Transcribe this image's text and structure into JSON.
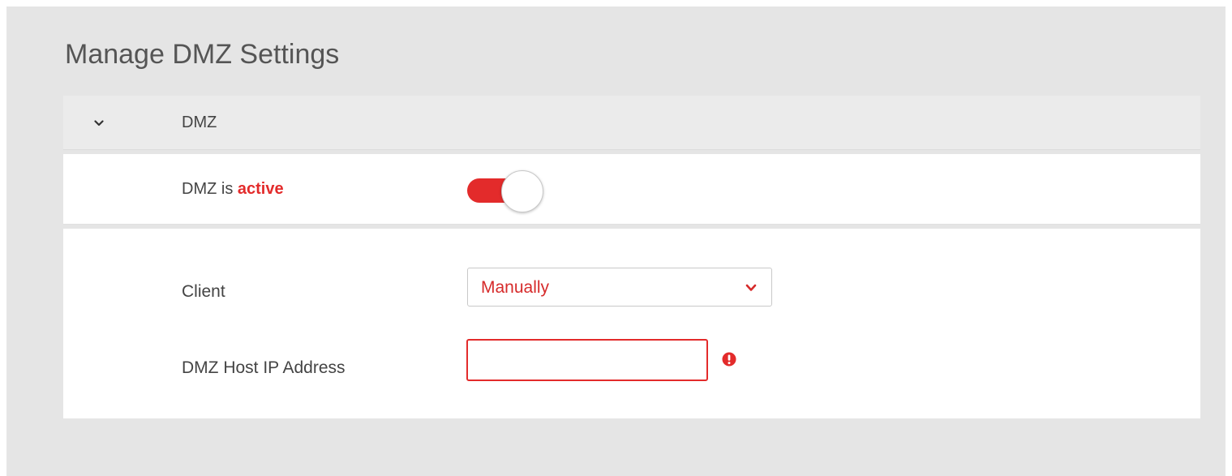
{
  "page": {
    "title": "Manage DMZ Settings"
  },
  "section": {
    "label": "DMZ",
    "expanded_icon": "chevron-down-icon"
  },
  "dmz_status": {
    "prefix": "DMZ is ",
    "state": "active",
    "toggle_on": true
  },
  "form": {
    "client_label": "Client",
    "client_value": "Manually",
    "ip_label": "DMZ Host IP Address",
    "ip_value": "",
    "ip_error_icon": "error-exclamation-icon"
  },
  "colors": {
    "accent": "#e32b2b",
    "background": "#e5e5e5",
    "text": "#444444"
  }
}
